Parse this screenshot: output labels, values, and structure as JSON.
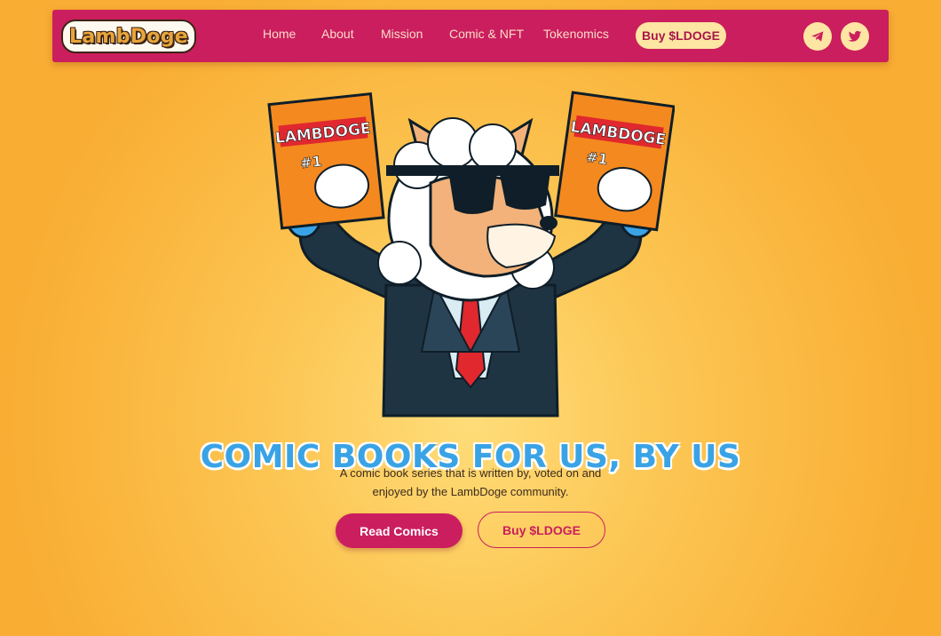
{
  "brand": {
    "logo_text": "LambDoge"
  },
  "nav": {
    "items": [
      {
        "label": "Home"
      },
      {
        "label": "About"
      },
      {
        "label": "Mission"
      },
      {
        "label": "Comic & NFT"
      },
      {
        "label": "Tokenomics"
      }
    ],
    "buy_button": "Buy $LDOGE",
    "social": [
      {
        "icon": "telegram-icon"
      },
      {
        "icon": "twitter-icon"
      }
    ]
  },
  "hero": {
    "illustration": "lambdoge-mascot-holding-comics",
    "comic_cover": {
      "title": "LAMBDOGE",
      "issue": "#1"
    },
    "headline": "COMIC BOOKS FOR US, BY US",
    "subtitle_line1": "A comic book series that is written by, voted on and",
    "subtitle_line2": "enjoyed by the LambDoge community.",
    "primary_button": "Read Comics",
    "secondary_button": "Buy $LDOGE"
  },
  "colors": {
    "brand_pink": "#cb1e5e",
    "accent_cream": "#fde5a3",
    "headline_blue": "#3aa3e6",
    "background_gold": "#fcc552"
  }
}
